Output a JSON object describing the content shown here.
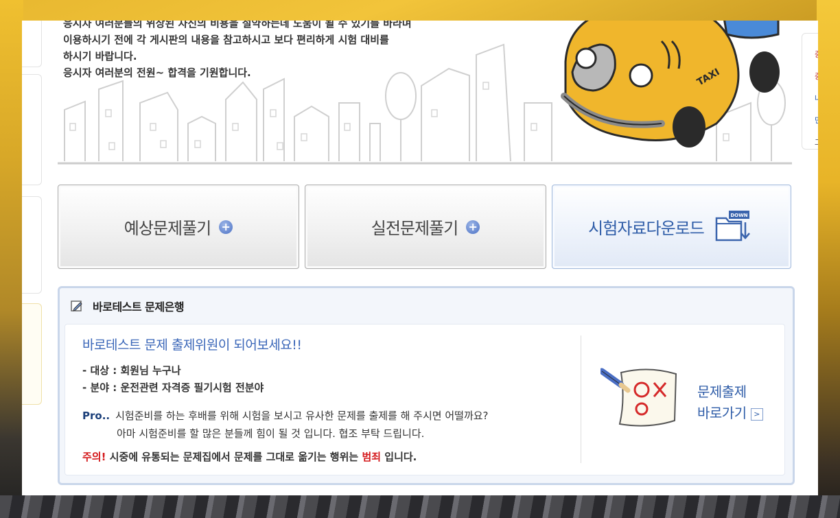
{
  "intro": {
    "line1": "응시자 여러분들의 위상된 자신의 비용을 절약하는데 도움이 될 수 있기를 바라며",
    "line2": "이용하시기  전에 각 게시판의 내용을 참고하시고 보다 편리하게 시험 대비를",
    "line3": "하시기 바랍니다.",
    "line4": "응시자 여러분의 전원~ 합격을 기원합니다."
  },
  "taxi_label": "TAXI",
  "download_badge": "DOWN",
  "buttons": {
    "expected": "예상문제풀기",
    "real": "실전문제풀기",
    "download": "시험자료다운로드",
    "plus": "+"
  },
  "bank": {
    "title": "바로테스트 문제은행",
    "headline": "바로테스트 문제 출제위원이 되어보세요!!",
    "target": "- 대상 : 회원님 누구나",
    "field": "- 분야 : 운전관련 자격증 필기시험 전분야",
    "pro_label": "Pro..",
    "pro_text": "시험준비를 하는 후배를 위해 시험을 보시고 유사한 문제를 출제를 해 주시면 어떨까요?",
    "pro_text2": "아마 시험준비를 할 많은 분들께 힘이 될 것 입니다. 협조 부탁 드립니다.",
    "warn_label": "주의!",
    "warn_text": " 시중에 유통되는 문제집에서 문제를 그대로 옮기는 행위는 ",
    "warn_crime": "범죄",
    "warn_end": " 입니다.",
    "go_line1": "문제출제",
    "go_line2": "바로가기",
    "go_arrow": ">"
  },
  "sidebar_right": {
    "c1": "중",
    "c2": "중",
    "c3": "나",
    "c4": "민",
    "c5": "그"
  },
  "colors": {
    "accent_blue": "#2f5da8",
    "warn_red": "#d4181b",
    "taxi_yellow": "#f0b62c"
  }
}
